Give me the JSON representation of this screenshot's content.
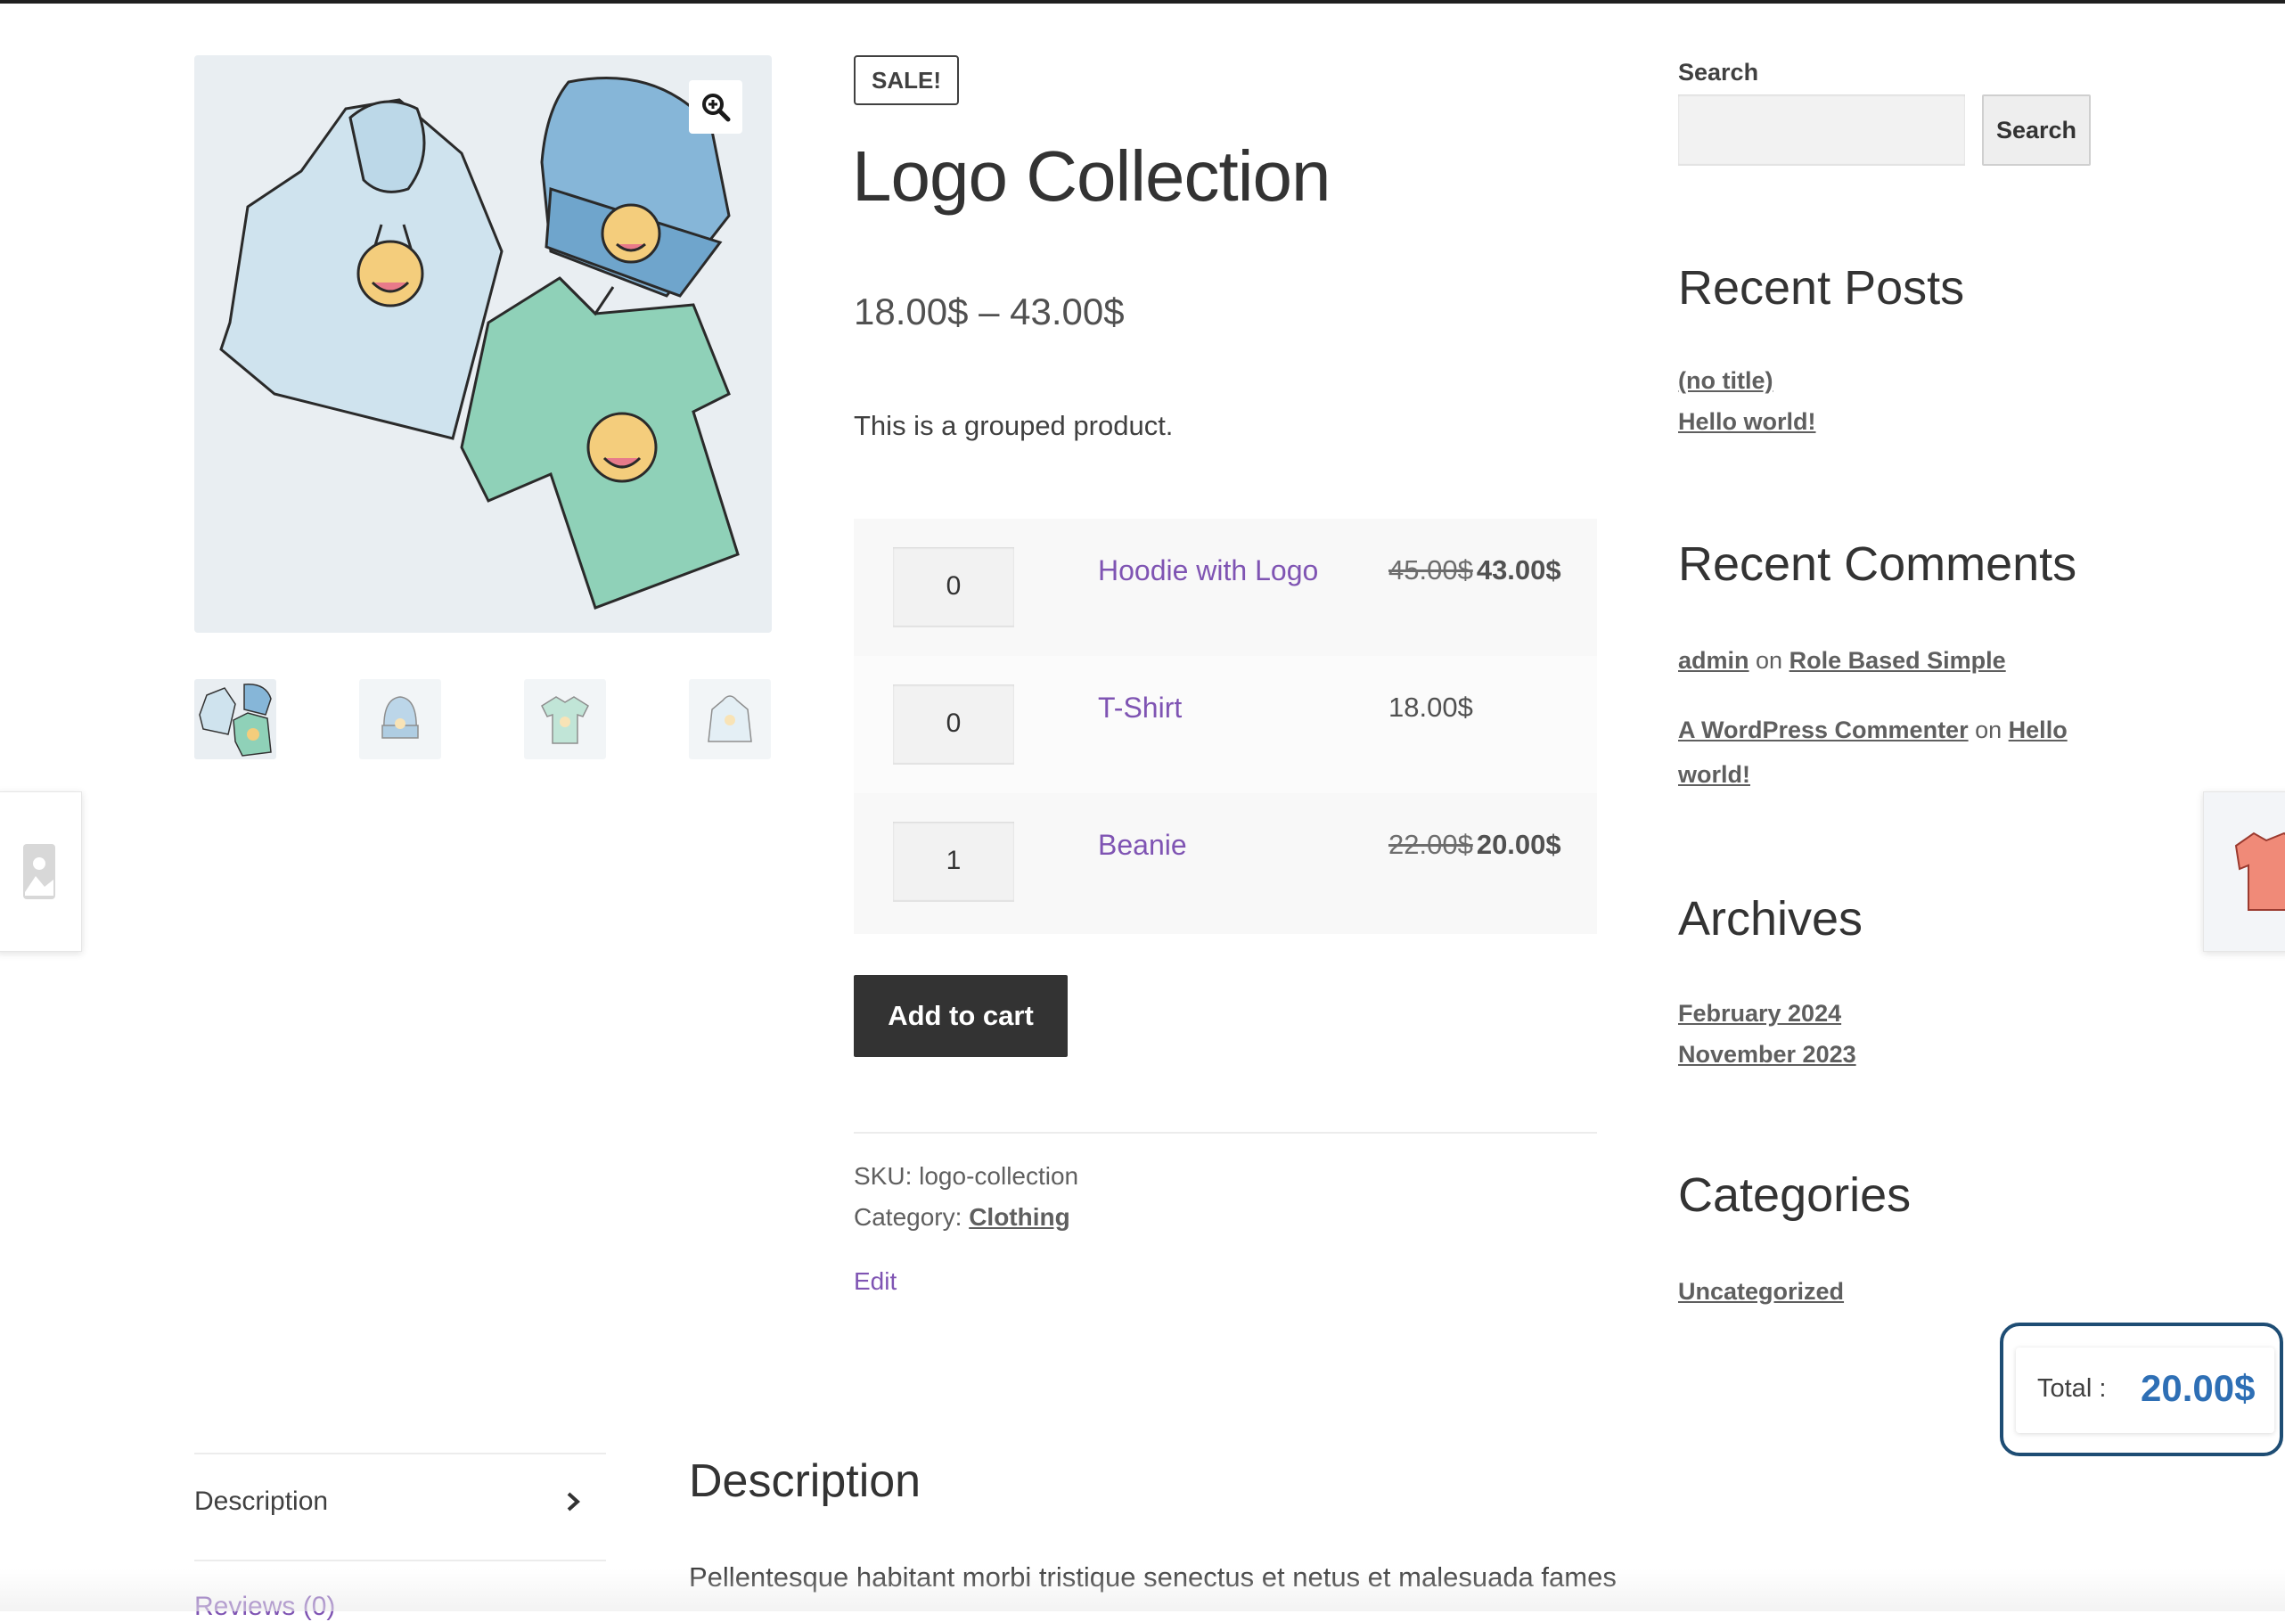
{
  "gallery": {
    "zoom_icon": "magnify-plus-icon",
    "thumbnails": [
      "logo-collection-thumb",
      "beanie-thumb",
      "tshirt-thumb",
      "hoodie-thumb"
    ]
  },
  "product": {
    "sale_badge": "SALE!",
    "title": "Logo Collection",
    "price_range": "18.00$ – 43.00$",
    "short_description": "This is a grouped product.",
    "items": [
      {
        "qty": "0",
        "name": "Hoodie with Logo",
        "regular_price": "45.00$",
        "sale_price": "43.00$"
      },
      {
        "qty": "0",
        "name": "T-Shirt",
        "price": "18.00$"
      },
      {
        "qty": "1",
        "name": "Beanie",
        "regular_price": "22.00$",
        "sale_price": "20.00$"
      }
    ],
    "add_to_cart_label": "Add to cart",
    "sku_label": "SKU:",
    "sku_value": "logo-collection",
    "category_label": "Category:",
    "category_value": "Clothing",
    "edit_label": "Edit"
  },
  "sidebar": {
    "search_label": "Search",
    "search_button": "Search",
    "recent_posts_title": "Recent Posts",
    "recent_posts": [
      "(no title)",
      "Hello world!"
    ],
    "recent_comments_title": "Recent Comments",
    "comments": [
      {
        "author": "admin",
        "on": "on",
        "post": "Role Based Simple"
      },
      {
        "author": "A WordPress Commenter",
        "on": "on",
        "post_line1": "Hello",
        "post_line2": "world!"
      }
    ],
    "archives_title": "Archives",
    "archives": [
      "February 2024",
      "November 2023"
    ],
    "categories_title": "Categories",
    "categories": [
      "Uncategorized"
    ]
  },
  "total_widget": {
    "label": "Total :",
    "value": "20.00$"
  },
  "tabs": {
    "description_tab": "Description",
    "reviews_tab": "Reviews (0)",
    "description_heading": "Description",
    "description_text": "Pellentesque habitant morbi tristique senectus et netus et malesuada fames"
  },
  "colors": {
    "link_purple": "#7f54b3",
    "total_blue": "#2e6fb5",
    "total_border": "#1e4d74",
    "button_dark": "#333333"
  }
}
